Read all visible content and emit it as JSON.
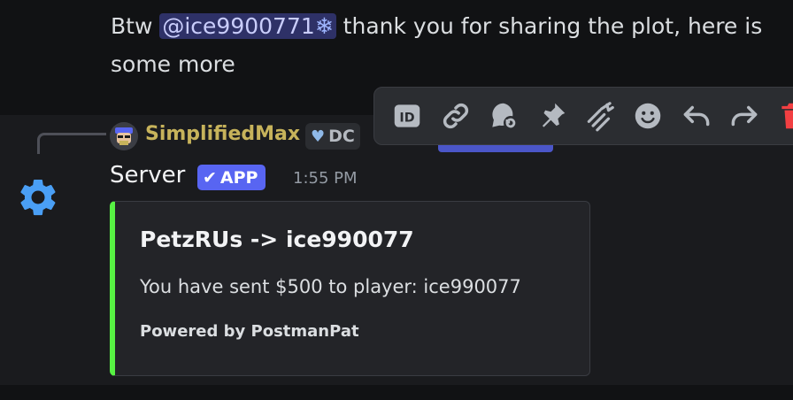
{
  "previous_message": {
    "prefix": "Btw ",
    "mention": "@ice9900771",
    "mention_suffix_icon": "snowflake-icon",
    "suffix": " thank you for sharing the plot, here is some more"
  },
  "reply": {
    "username": "SimplifiedMax",
    "username_color": "#c7b35b",
    "tag": "DC"
  },
  "message": {
    "author": "Server",
    "badge": "APP",
    "timestamp": "1:55 PM"
  },
  "embed": {
    "accent_color": "#57f243",
    "title": "PetzRUs -> ice990077",
    "description": "You have sent $500 to player: ice990077",
    "footer": "Powered by PostmanPat"
  },
  "toolbar": {
    "buttons": [
      "id-icon",
      "link-icon",
      "thread-icon",
      "pin-icon",
      "forward-icon",
      "emoji-icon",
      "reply-icon",
      "share-icon",
      "delete-icon"
    ]
  }
}
